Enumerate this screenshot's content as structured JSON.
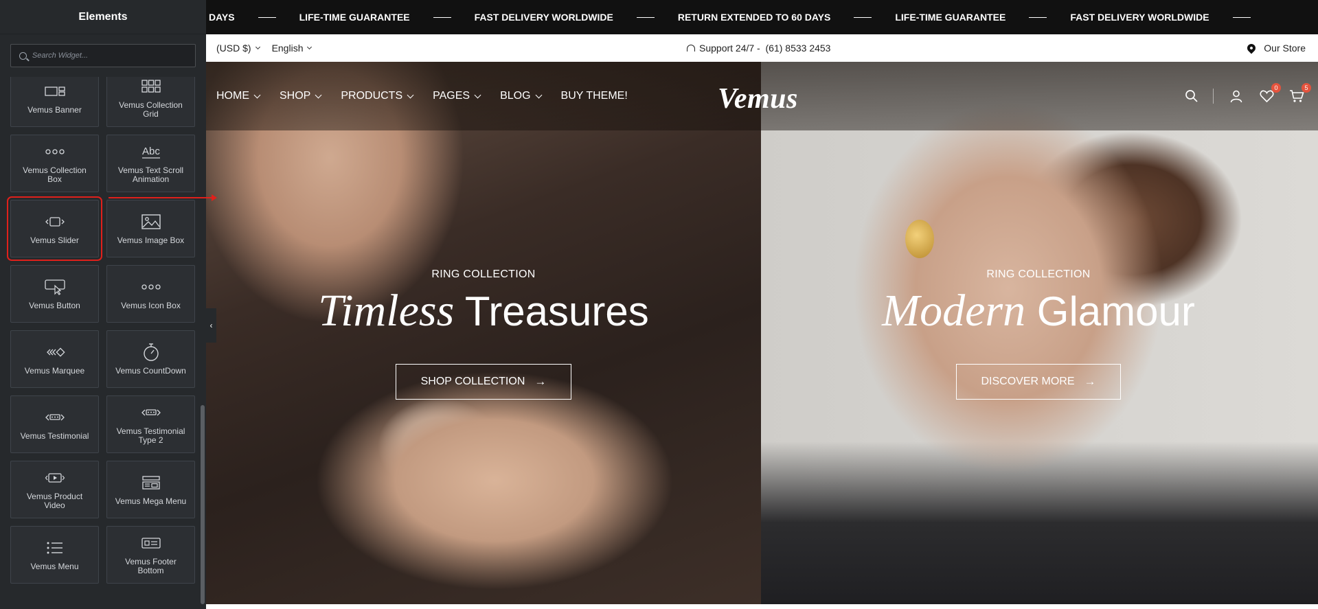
{
  "sidebar": {
    "title": "Elements",
    "search_placeholder": "Search Widget...",
    "widgets": [
      {
        "label": "Vemus Banner",
        "icon": "banner-icon"
      },
      {
        "label": "Vemus Collection Grid",
        "icon": "grid-icon"
      },
      {
        "label": "Vemus Collection Box",
        "icon": "dots-icon"
      },
      {
        "label": "Vemus Text Scroll Animation",
        "icon": "text-abc-icon"
      },
      {
        "label": "Vemus Slider",
        "icon": "slider-icon"
      },
      {
        "label": "Vemus Image Box",
        "icon": "image-icon"
      },
      {
        "label": "Vemus Button",
        "icon": "button-cursor-icon"
      },
      {
        "label": "Vemus Icon Box",
        "icon": "dots-icon"
      },
      {
        "label": "Vemus Marquee",
        "icon": "marquee-icon"
      },
      {
        "label": "Vemus CountDown",
        "icon": "stopwatch-icon"
      },
      {
        "label": "Vemus Testimonial",
        "icon": "testimonial-icon"
      },
      {
        "label": "Vemus Testimonial Type 2",
        "icon": "testimonial-icon"
      },
      {
        "label": "Vemus Product Video",
        "icon": "video-icon"
      },
      {
        "label": "Vemus Mega Menu",
        "icon": "mega-menu-icon"
      },
      {
        "label": "Vemus Menu",
        "icon": "list-icon"
      },
      {
        "label": "Vemus Footer Bottom",
        "icon": "footer-icon"
      }
    ],
    "selected_widget": "Vemus Slider"
  },
  "marquee": {
    "items": [
      "DAYS",
      "LIFE-TIME GUARANTEE",
      "FAST DELIVERY WORLDWIDE",
      "RETURN EXTENDED TO 60 DAYS",
      "LIFE-TIME GUARANTEE",
      "FAST DELIVERY WORLDWIDE"
    ]
  },
  "topbar": {
    "currency": "(USD $)",
    "language": "English",
    "support": "Support 24/7 -  (61) 8533 2453",
    "store": "Our Store"
  },
  "nav": {
    "items": [
      "HOME",
      "SHOP",
      "PRODUCTS",
      "PAGES",
      "BLOG",
      "BUY THEME!"
    ],
    "logo": "Vemus",
    "wishlist_count": "0",
    "cart_count": "5"
  },
  "hero": {
    "left": {
      "subtitle": "RING COLLECTION",
      "title_italic": "Timless",
      "title_regular": "Treasures",
      "button": "SHOP COLLECTION"
    },
    "right": {
      "subtitle": "RING COLLECTION",
      "title_italic": "Modern",
      "title_regular": "Glamour",
      "button": "DISCOVER MORE"
    }
  },
  "colors": {
    "accent": "#e0201b",
    "panel_bg": "#26292c",
    "badge": "#e5533d"
  }
}
